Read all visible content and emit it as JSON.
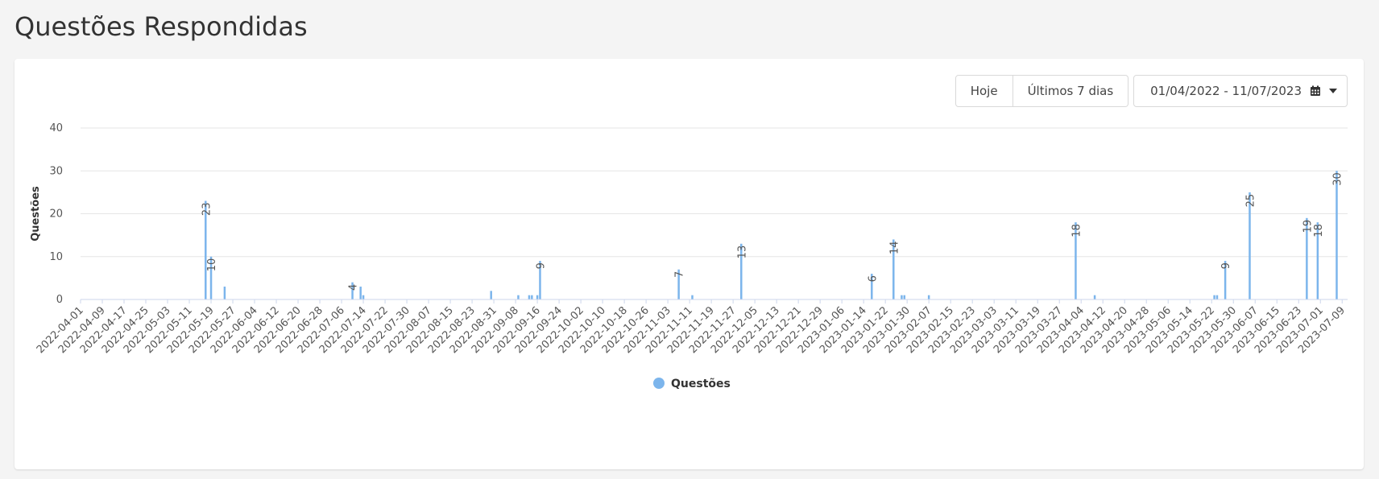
{
  "page": {
    "title": "Questões Respondidas"
  },
  "toolbar": {
    "today_label": "Hoje",
    "last7_label": "Últimos 7 dias",
    "date_range_label": "01/04/2022 - 11/07/2023",
    "calendar_icon": "calendar-icon",
    "dropdown_icon": "caret-down-icon"
  },
  "colors": {
    "series": "#7cb5ec",
    "grid": "#e6e6e6"
  },
  "chart_data": {
    "type": "bar",
    "title": "",
    "xlabel": "",
    "ylabel": "Questões",
    "ylim": [
      0,
      40
    ],
    "yticks": [
      0,
      10,
      20,
      30,
      40
    ],
    "xlim": [
      "2022-04-01",
      "2023-07-11"
    ],
    "xticks": [
      "2022-04-01",
      "2022-04-09",
      "2022-04-17",
      "2022-04-25",
      "2022-05-03",
      "2022-05-11",
      "2022-05-19",
      "2022-05-27",
      "2022-06-04",
      "2022-06-12",
      "2022-06-20",
      "2022-06-28",
      "2022-07-06",
      "2022-07-14",
      "2022-07-22",
      "2022-07-30",
      "2022-08-07",
      "2022-08-15",
      "2022-08-23",
      "2022-08-31",
      "2022-09-08",
      "2022-09-16",
      "2022-09-24",
      "2022-10-02",
      "2022-10-10",
      "2022-10-18",
      "2022-10-26",
      "2022-11-03",
      "2022-11-11",
      "2022-11-19",
      "2022-11-27",
      "2022-12-05",
      "2022-12-13",
      "2022-12-21",
      "2022-12-29",
      "2023-01-06",
      "2023-01-14",
      "2023-01-22",
      "2023-01-30",
      "2023-02-07",
      "2023-02-15",
      "2023-02-23",
      "2023-03-03",
      "2023-03-11",
      "2023-03-19",
      "2023-03-27",
      "2023-04-04",
      "2023-04-12",
      "2023-04-20",
      "2023-04-28",
      "2023-05-06",
      "2023-05-14",
      "2023-05-22",
      "2023-05-30",
      "2023-06-07",
      "2023-06-15",
      "2023-06-23",
      "2023-07-01",
      "2023-07-09"
    ],
    "grid": true,
    "legend": "bottom-center",
    "series": [
      {
        "name": "Questões",
        "color": "#7cb5ec",
        "points": [
          {
            "x": "2022-05-17",
            "y": 23,
            "label": "23"
          },
          {
            "x": "2022-05-19",
            "y": 10,
            "label": "10"
          },
          {
            "x": "2022-05-24",
            "y": 3
          },
          {
            "x": "2022-07-10",
            "y": 4,
            "label": "4"
          },
          {
            "x": "2022-07-13",
            "y": 3
          },
          {
            "x": "2022-07-14",
            "y": 1
          },
          {
            "x": "2022-08-30",
            "y": 2
          },
          {
            "x": "2022-09-09",
            "y": 1
          },
          {
            "x": "2022-09-13",
            "y": 1
          },
          {
            "x": "2022-09-14",
            "y": 1
          },
          {
            "x": "2022-09-16",
            "y": 1
          },
          {
            "x": "2022-09-17",
            "y": 9,
            "label": "9"
          },
          {
            "x": "2022-11-07",
            "y": 7,
            "label": "7"
          },
          {
            "x": "2022-11-12",
            "y": 1
          },
          {
            "x": "2022-11-30",
            "y": 13,
            "label": "13"
          },
          {
            "x": "2023-01-17",
            "y": 6,
            "label": "6"
          },
          {
            "x": "2023-01-25",
            "y": 14,
            "label": "14"
          },
          {
            "x": "2023-01-28",
            "y": 1
          },
          {
            "x": "2023-01-29",
            "y": 1
          },
          {
            "x": "2023-02-07",
            "y": 1
          },
          {
            "x": "2023-04-02",
            "y": 18,
            "label": "18"
          },
          {
            "x": "2023-04-09",
            "y": 1
          },
          {
            "x": "2023-05-23",
            "y": 1
          },
          {
            "x": "2023-05-24",
            "y": 1
          },
          {
            "x": "2023-05-27",
            "y": 9,
            "label": "9"
          },
          {
            "x": "2023-06-05",
            "y": 25,
            "label": "25"
          },
          {
            "x": "2023-06-26",
            "y": 19,
            "label": "19"
          },
          {
            "x": "2023-06-30",
            "y": 18,
            "label": "18"
          },
          {
            "x": "2023-07-07",
            "y": 30,
            "label": "30"
          }
        ]
      }
    ]
  }
}
